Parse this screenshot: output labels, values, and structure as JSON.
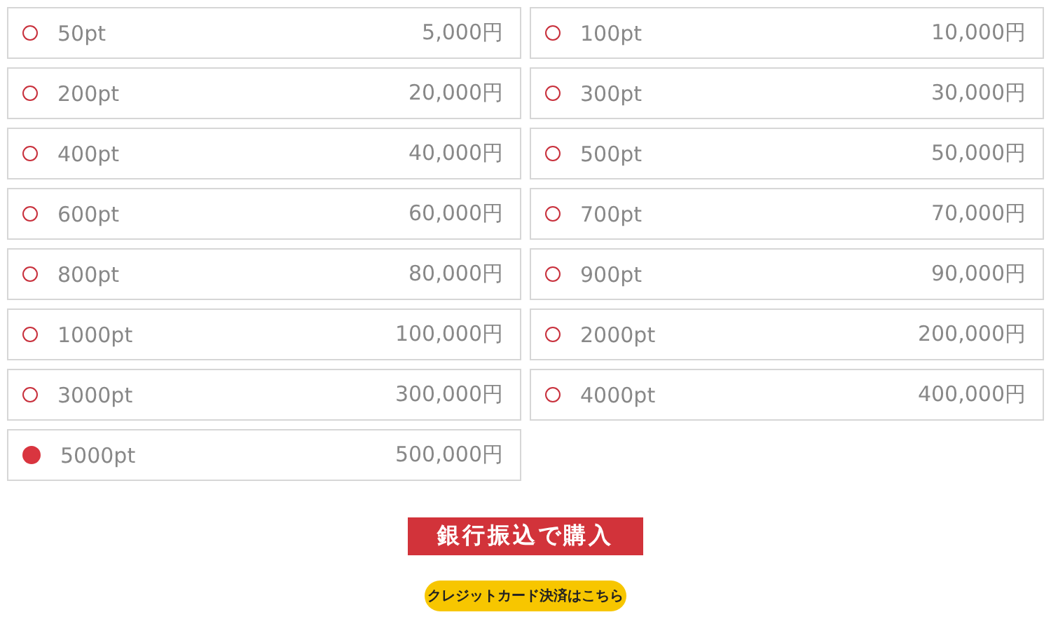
{
  "options": [
    {
      "points": "50pt",
      "price": "5,000円",
      "selected": false
    },
    {
      "points": "100pt",
      "price": "10,000円",
      "selected": false
    },
    {
      "points": "200pt",
      "price": "20,000円",
      "selected": false
    },
    {
      "points": "300pt",
      "price": "30,000円",
      "selected": false
    },
    {
      "points": "400pt",
      "price": "40,000円",
      "selected": false
    },
    {
      "points": "500pt",
      "price": "50,000円",
      "selected": false
    },
    {
      "points": "600pt",
      "price": "60,000円",
      "selected": false
    },
    {
      "points": "700pt",
      "price": "70,000円",
      "selected": false
    },
    {
      "points": "800pt",
      "price": "80,000円",
      "selected": false
    },
    {
      "points": "900pt",
      "price": "90,000円",
      "selected": false
    },
    {
      "points": "1000pt",
      "price": "100,000円",
      "selected": false
    },
    {
      "points": "2000pt",
      "price": "200,000円",
      "selected": false
    },
    {
      "points": "3000pt",
      "price": "300,000円",
      "selected": false
    },
    {
      "points": "4000pt",
      "price": "400,000円",
      "selected": false
    },
    {
      "points": "5000pt",
      "price": "500,000円",
      "selected": true
    }
  ],
  "bank_button": "銀行振込で購入",
  "card_button": "クレジットカード決済はこちら"
}
